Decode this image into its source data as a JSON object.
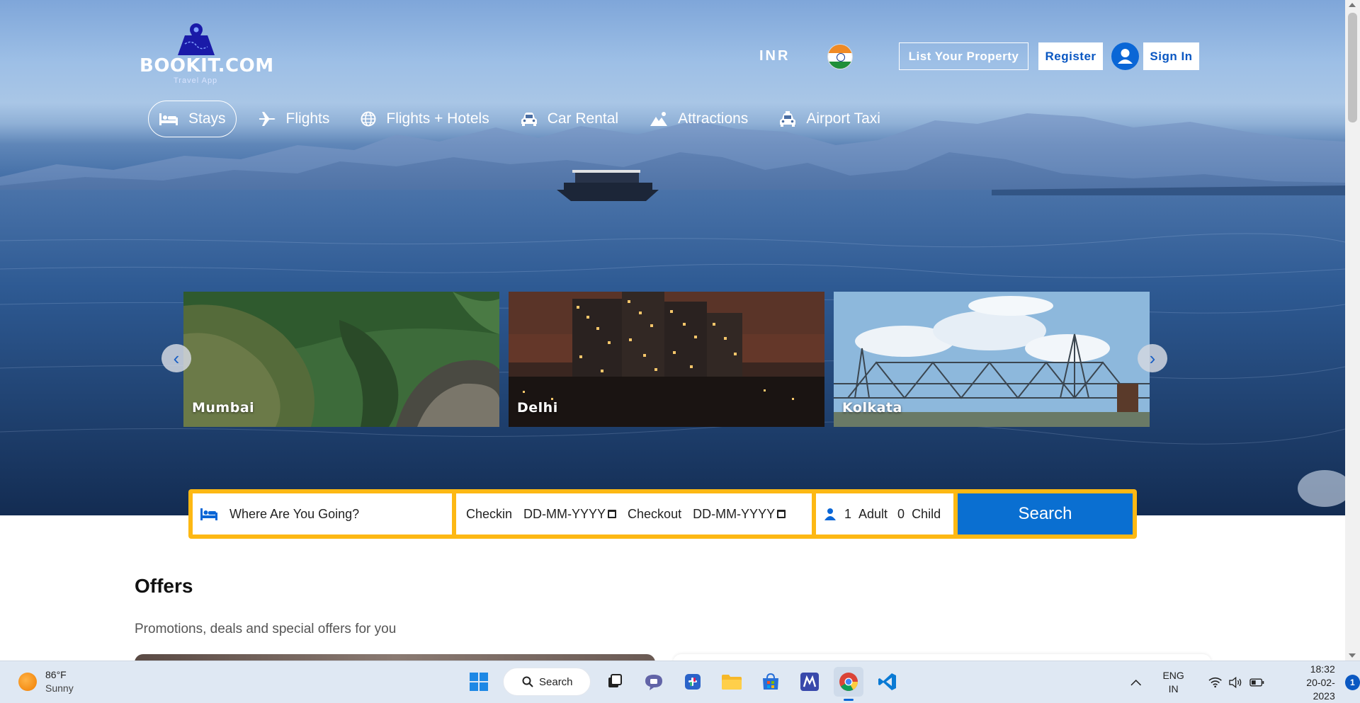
{
  "brand": {
    "name": "BOOKIT.COM",
    "tagline": "Travel App"
  },
  "header": {
    "currency": "INR",
    "list_property": "List Your Property",
    "register": "Register",
    "sign_in": "Sign In"
  },
  "nav": [
    {
      "label": "Stays",
      "icon": "bed-icon",
      "active": true
    },
    {
      "label": "Flights",
      "icon": "plane-icon"
    },
    {
      "label": "Flights + Hotels",
      "icon": "globe-icon"
    },
    {
      "label": "Car Rental",
      "icon": "car-icon"
    },
    {
      "label": "Attractions",
      "icon": "mountain-icon"
    },
    {
      "label": "Airport Taxi",
      "icon": "taxi-icon"
    }
  ],
  "carousel": {
    "prev": "‹",
    "next": "›",
    "cities": [
      {
        "name": "Mumbai"
      },
      {
        "name": "Delhi"
      },
      {
        "name": "Kolkata"
      }
    ]
  },
  "search": {
    "destination_placeholder": "Where Are You Going?",
    "checkin_label": "Checkin",
    "checkin_value": "DD-MM-YYYY",
    "checkout_label": "Checkout",
    "checkout_value": "DD-MM-YYYY",
    "adults_count": "1",
    "adults_label": "Adult",
    "children_count": "0",
    "children_label": "Child",
    "button": "Search"
  },
  "offers": {
    "title": "Offers",
    "subtitle": "Promotions, deals and special offers for you"
  },
  "taskbar": {
    "weather_temp": "86°F",
    "weather_desc": "Sunny",
    "search_label": "Search",
    "lang_line1": "ENG",
    "lang_line2": "IN",
    "time": "18:32",
    "date": "20-02-2023",
    "notifications": "1"
  },
  "colors": {
    "accent_blue": "#0a6fd1",
    "search_border": "#fdb813",
    "brand_blue": "#0a57c2"
  }
}
